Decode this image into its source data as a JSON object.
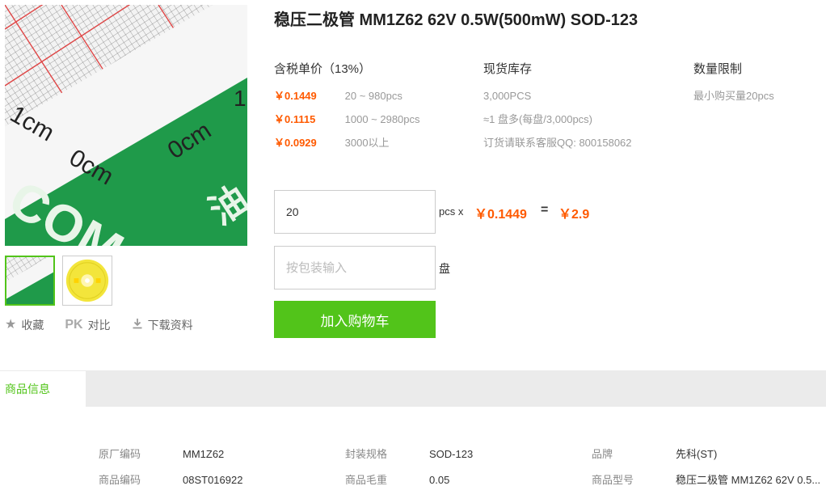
{
  "product": {
    "title": "稳压二极管 MM1Z62 62V 0.5W(500mW) SOD-123"
  },
  "images": {
    "ruler_labels": [
      "1cm",
      "0cm",
      "0cm",
      "1"
    ],
    "brand_text": "COM",
    "brand_cn": "油"
  },
  "actions": {
    "favorite_icon": "star-icon",
    "favorite": "收藏",
    "compare_badge": "PK",
    "compare": "对比",
    "download_icon": "download-icon",
    "download": "下载资料"
  },
  "pricing": {
    "header": "含税单价（13%）",
    "tiers": [
      {
        "price": "￥0.1449",
        "range": "20 ~ 980pcs"
      },
      {
        "price": "￥0.1115",
        "range": "1000 ~ 2980pcs"
      },
      {
        "price": "￥0.0929",
        "range": "3000以上"
      }
    ]
  },
  "stock": {
    "header": "现货库存",
    "lines": [
      "3,000PCS",
      "≈1 盘多(每盘/3,000pcs)",
      "订货请联系客服QQ: 800158062"
    ]
  },
  "limit": {
    "header": "数量限制",
    "lines": [
      "最小购买量20pcs"
    ]
  },
  "order": {
    "quantity_value": "20",
    "quantity_unit": "pcs x",
    "unit_price": "￥0.1449",
    "equals": "=",
    "total": "￥2.9",
    "pack_placeholder": "按包装输入",
    "pack_unit": "盘",
    "add_to_cart": "加入购物车"
  },
  "tabs": {
    "product_info": "商品信息"
  },
  "specs": [
    {
      "key": "原厂编码",
      "value": "MM1Z62"
    },
    {
      "key": "封装规格",
      "value": "SOD-123"
    },
    {
      "key": "品牌",
      "value": "先科(ST)"
    },
    {
      "key": "商品编码",
      "value": "08ST016922"
    },
    {
      "key": "商品毛重",
      "value": "0.05"
    },
    {
      "key": "商品型号",
      "value": "稳压二极管 MM1Z62 62V 0.5..."
    }
  ],
  "colors": {
    "accent_green": "#52c41a",
    "price_orange": "#ff5a00"
  }
}
